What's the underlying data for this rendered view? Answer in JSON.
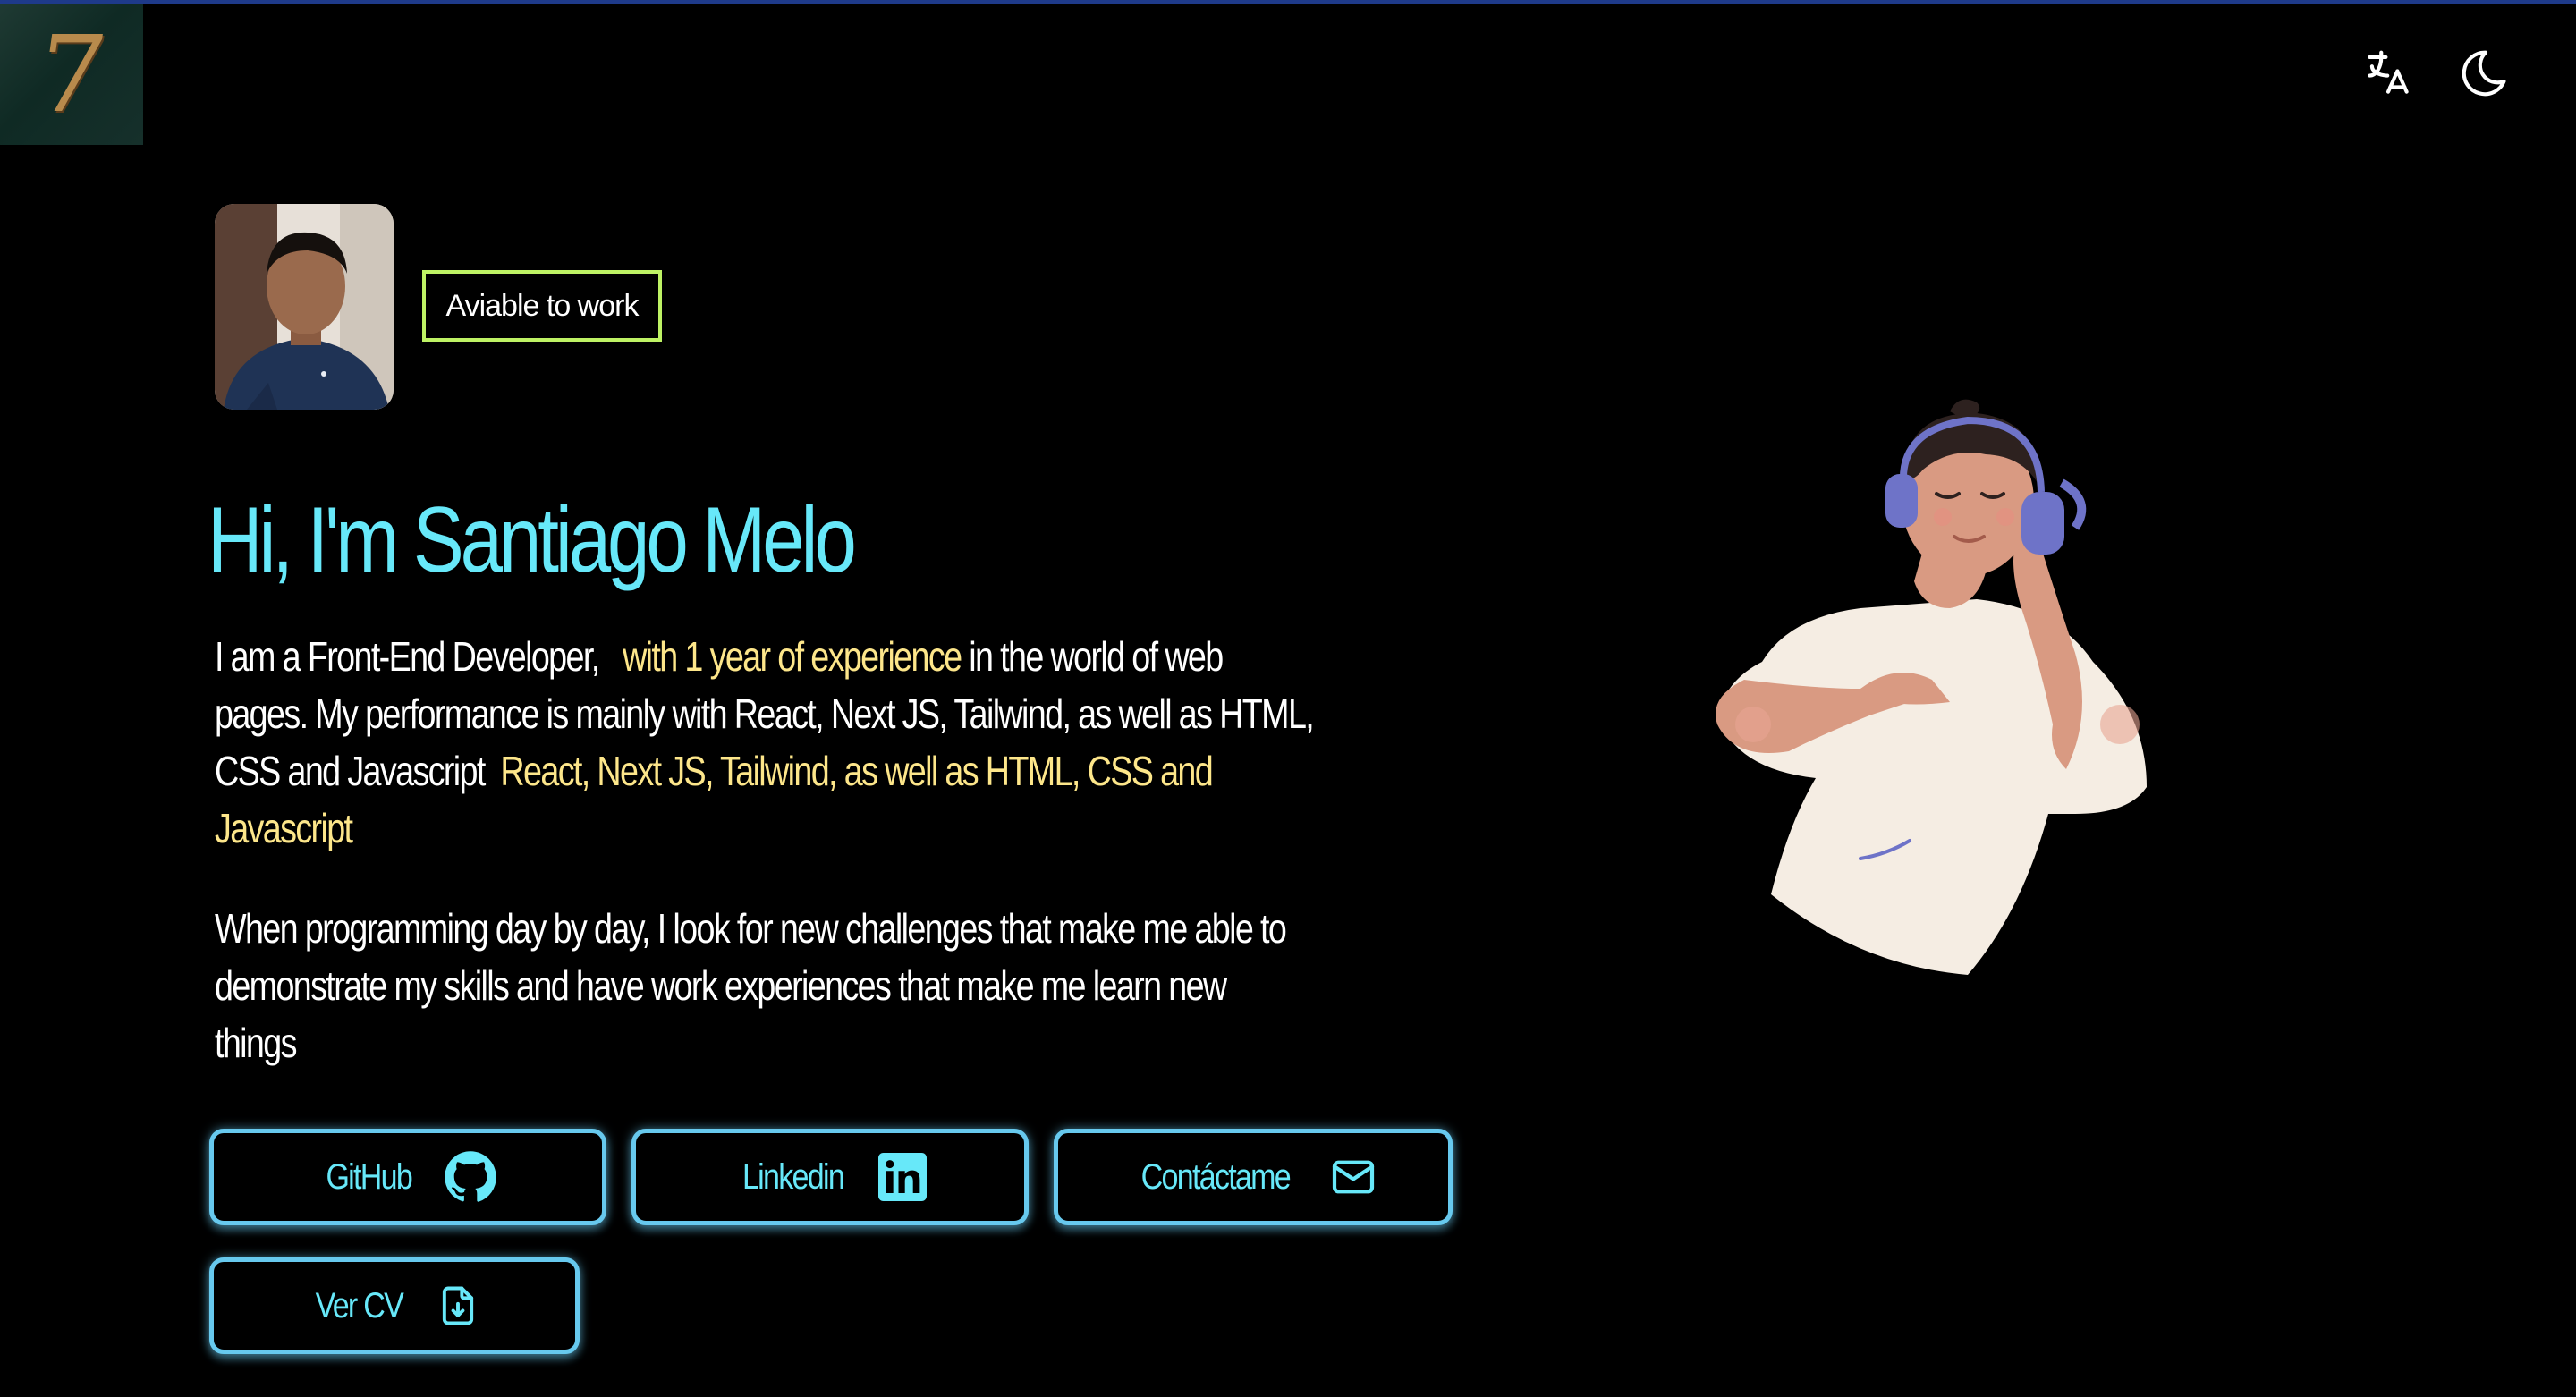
{
  "header": {
    "logo_text": "7",
    "translate_icon": "translate-icon",
    "theme_icon": "moon-icon"
  },
  "hero": {
    "status": "Aviable to work",
    "title": "Hi, I'm Santiago Melo",
    "intro": {
      "part1": "I am a Front-End Developer,",
      "highlight1": "with 1 year of experience",
      "part2": "in the world of web pages. My performance is mainly with React, Next JS, Tailwind, as well as HTML, CSS and Javascript",
      "highlight2": "React, Next JS, Tailwind, as well as HTML, CSS and Javascript"
    },
    "description": "When programming day by day, I look for new challenges that make me able to demonstrate my skills and have work experiences that make me learn new things"
  },
  "buttons": {
    "github": "GitHub",
    "linkedin": "Linkedin",
    "contact": "Contáctame",
    "cv": "Ver CV"
  },
  "colors": {
    "accent": "#67e8f9",
    "highlight": "#fde68a",
    "badge_border": "#bef264",
    "button_border": "#67c9ee",
    "background": "#000000"
  }
}
